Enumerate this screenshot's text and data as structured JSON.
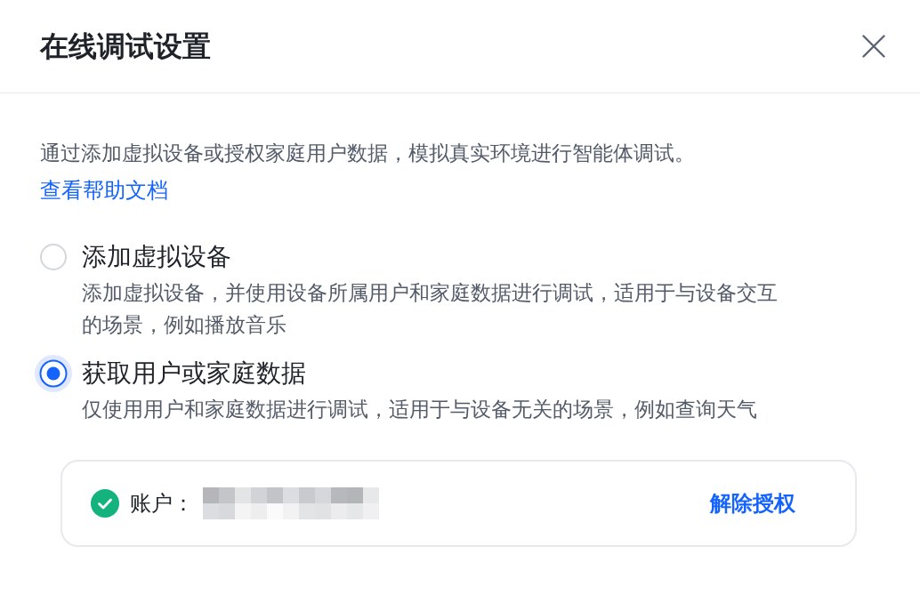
{
  "dialog": {
    "title": "在线调试设置"
  },
  "intro": {
    "text": "通过添加虚拟设备或授权家庭用户数据，模拟真实环境进行智能体调试。",
    "help_link": "查看帮助文档"
  },
  "options": [
    {
      "label": "添加虚拟设备",
      "description": "添加虚拟设备，并使用设备所属用户和家庭数据进行调试，适用于与设备交互的场景，例如播放音乐",
      "selected": false
    },
    {
      "label": "获取用户或家庭数据",
      "description": "仅使用用户和家庭数据进行调试，适用于与设备无关的场景，例如查询天气",
      "selected": true
    }
  ],
  "account": {
    "label": "账户：",
    "verified": true,
    "action": "解除授权"
  }
}
